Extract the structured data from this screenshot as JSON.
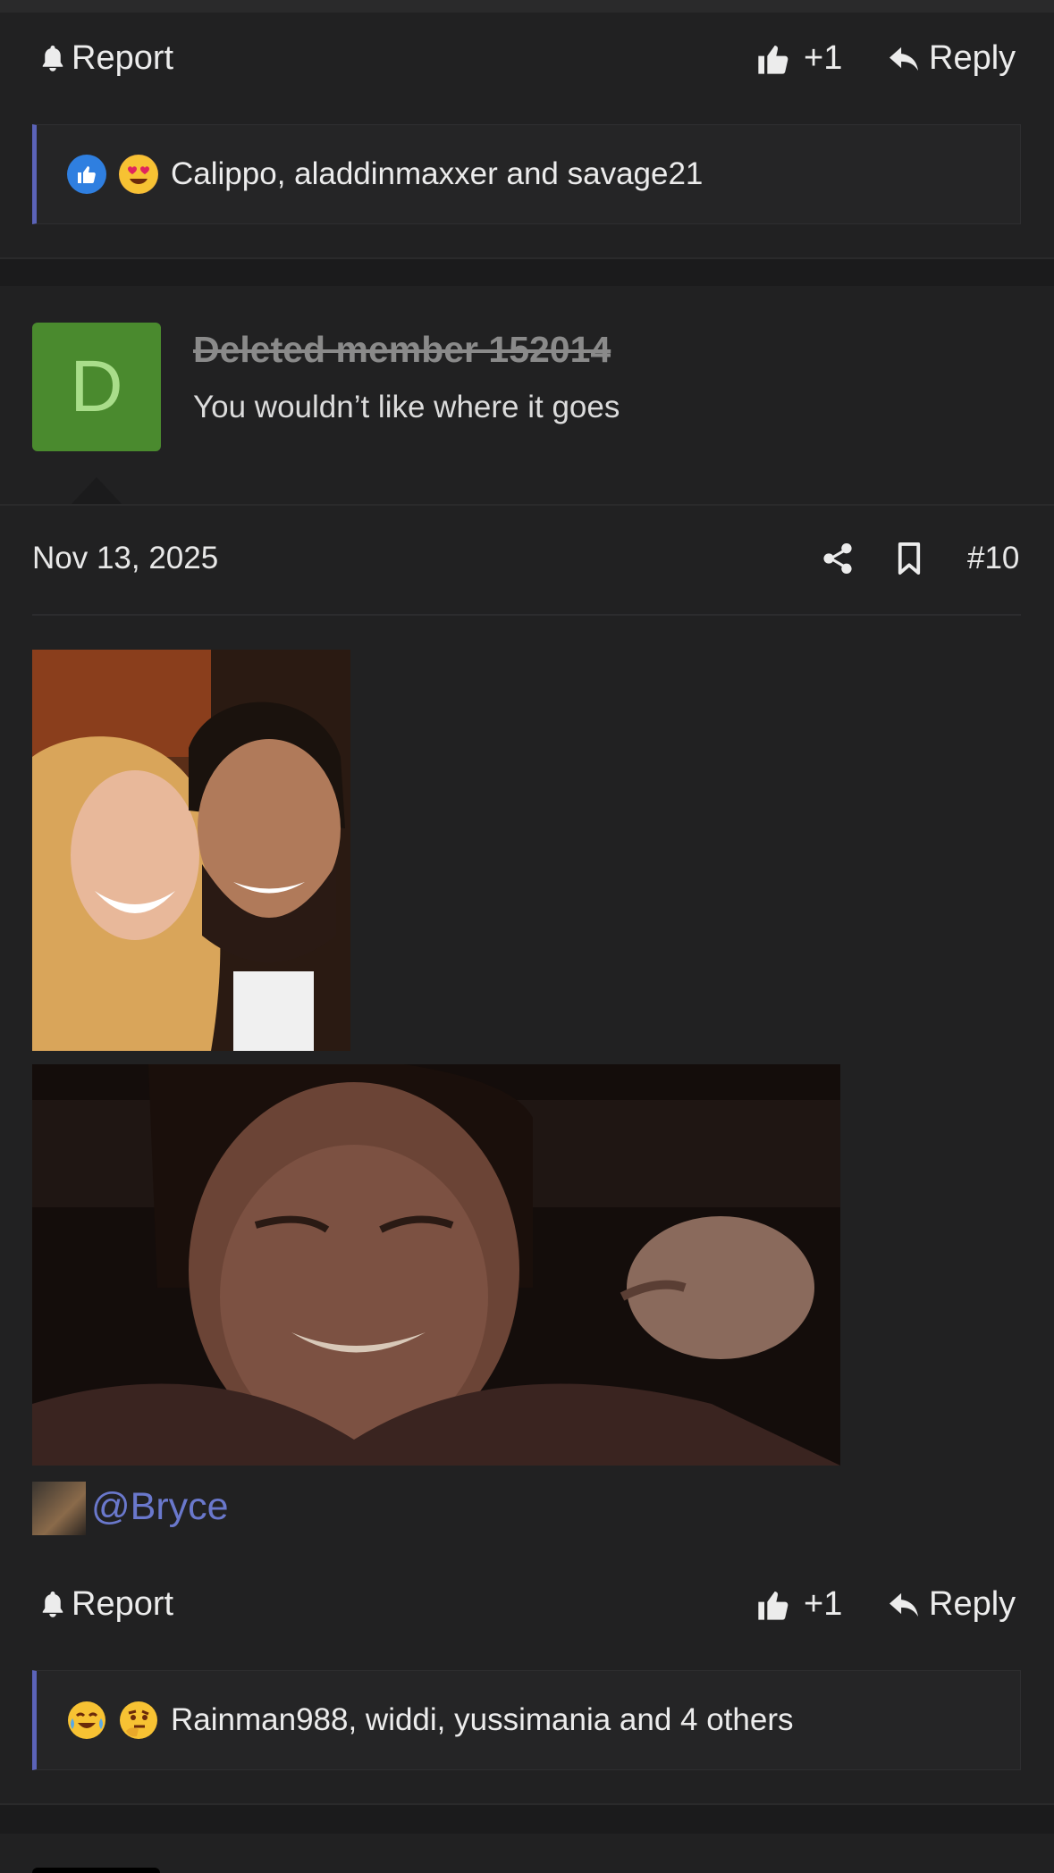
{
  "post_top": {
    "actions": {
      "report": "Report",
      "like_count": "+1",
      "reply": "Reply"
    },
    "reactions": {
      "emojis": [
        "like",
        "love"
      ],
      "text": "Calippo, aladdinmaxxer and savage21"
    }
  },
  "post": {
    "avatar_letter": "D",
    "username": "Deleted member 152014",
    "user_title": "You wouldn’t like where it goes",
    "date": "Nov 13, 2025",
    "post_number": "#10",
    "mention": "@Bryce",
    "actions": {
      "report": "Report",
      "like_count": "+1",
      "reply": "Reply"
    },
    "reactions": {
      "emojis": [
        "laughing-crying",
        "thinking"
      ],
      "text": "Rainman988, widdi, yussimania and 4 others"
    }
  },
  "colors": {
    "accent": "#5b63b8",
    "mention": "#6a78cc",
    "avatar_bg": "#4a8a2e",
    "background": "#1d1d1e"
  }
}
